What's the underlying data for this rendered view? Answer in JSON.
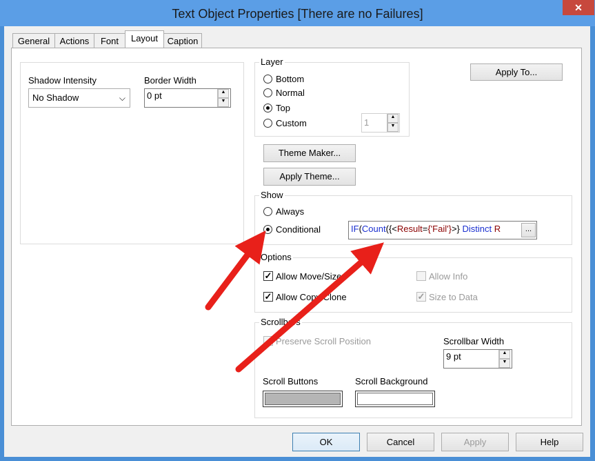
{
  "window": {
    "title": "Text Object Properties [There are no Failures]",
    "close": "✕"
  },
  "tabs": [
    "General",
    "Actions",
    "Font",
    "Layout",
    "Caption"
  ],
  "left_panel": {
    "shadow_label": "Shadow Intensity",
    "shadow_value": "No Shadow",
    "border_label": "Border Width",
    "border_value": "0 pt"
  },
  "layer": {
    "legend": "Layer",
    "options": [
      "Bottom",
      "Normal",
      "Top",
      "Custom"
    ],
    "selected": "Top",
    "custom_value": "1"
  },
  "apply_to": "Apply To...",
  "theme_maker": "Theme Maker...",
  "apply_theme": "Apply Theme...",
  "show": {
    "legend": "Show",
    "always": "Always",
    "conditional": "Conditional",
    "expr": {
      "fn1": "IF",
      "p1": "(",
      "fn2": "Count",
      "p2": "({<",
      "field": "Result",
      "eq": "=",
      "str": "{'Fail'}",
      "close": ">} ",
      "kw": "Distinct",
      "tail": " R"
    },
    "expr_button": "..."
  },
  "options": {
    "legend": "Options",
    "allow_move": "Allow Move/Size",
    "allow_copy": "Allow Copy/Clone",
    "allow_info": "Allow Info",
    "size_to_data": "Size to Data"
  },
  "scrollbars": {
    "legend": "Scrollbars",
    "preserve": "Preserve Scroll Position",
    "width_label": "Scrollbar Width",
    "width_value": "9 pt",
    "buttons_label": "Scroll Buttons",
    "background_label": "Scroll Background",
    "buttons_color": "#b5b5b5",
    "background_color": "#ffffff"
  },
  "footer": {
    "ok": "OK",
    "cancel": "Cancel",
    "apply": "Apply",
    "help": "Help"
  },
  "colors": {
    "accent": "#4a8fd6",
    "arrow": "#e8201a",
    "expr_fn": "#1a2fd0",
    "expr_field": "#8b0000"
  }
}
